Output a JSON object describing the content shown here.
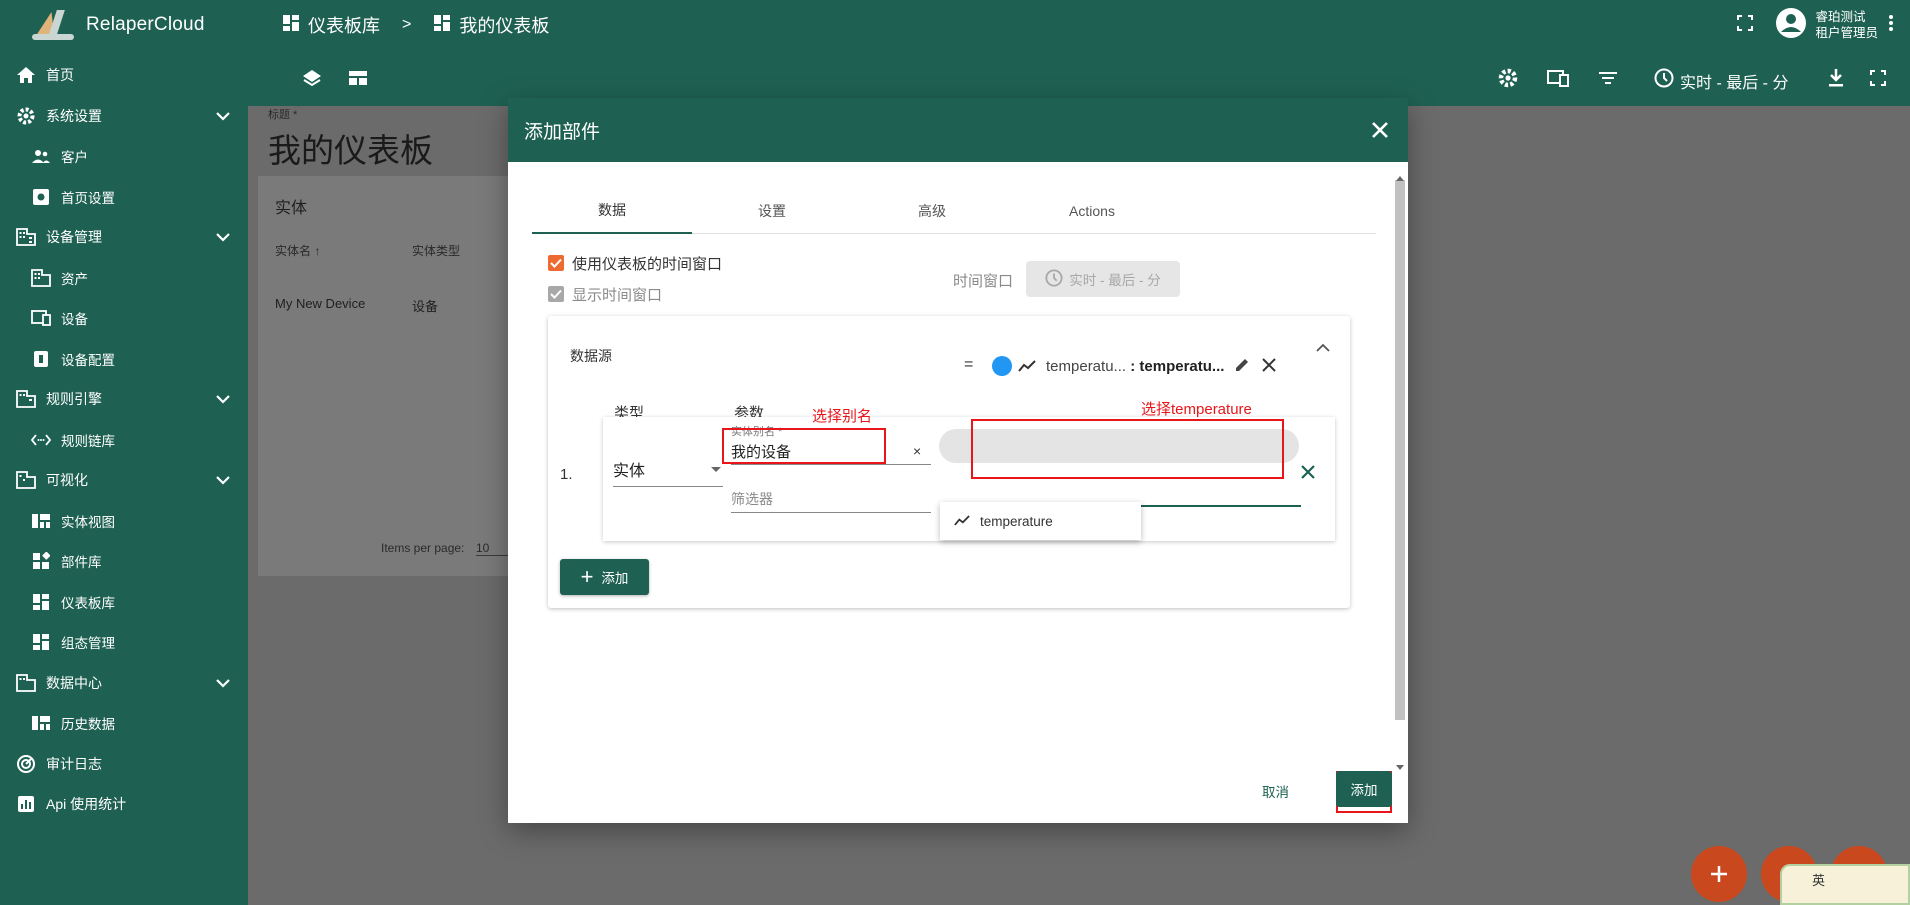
{
  "app": {
    "name": "RelaperCloud"
  },
  "sidebar": {
    "items": [
      {
        "label": "首页"
      },
      {
        "label": "系统设置"
      },
      {
        "label": "客户"
      },
      {
        "label": "首页设置"
      },
      {
        "label": "设备管理"
      },
      {
        "label": "资产"
      },
      {
        "label": "设备"
      },
      {
        "label": "设备配置"
      },
      {
        "label": "规则引擎"
      },
      {
        "label": "规则链库"
      },
      {
        "label": "可视化"
      },
      {
        "label": "实体视图"
      },
      {
        "label": "部件库"
      },
      {
        "label": "仪表板库"
      },
      {
        "label": "组态管理"
      },
      {
        "label": "数据中心"
      },
      {
        "label": "历史数据"
      },
      {
        "label": "审计日志"
      },
      {
        "label": "Api 使用统计"
      }
    ]
  },
  "breadcrumb": {
    "root": "仪表板库",
    "sep": ">",
    "current": "我的仪表板"
  },
  "user": {
    "name": "睿珀测试",
    "role": "租户管理员"
  },
  "toolbar": {
    "time_label": "实时 - 最后 - 分"
  },
  "dashboard": {
    "title_label": "标题 *",
    "title": "我的仪表板",
    "card_title": "实体",
    "col_name": "实体名 ↑",
    "col_type": "实体类型",
    "row_name": "My New Device",
    "row_type": "设备",
    "items_per_page_label": "Items per page:",
    "items_per_page": "10"
  },
  "dialog": {
    "title": "添加部件",
    "tabs": [
      "数据",
      "设置",
      "高级",
      "Actions"
    ],
    "use_dashboard_timewindow": "使用仪表板的时间窗口",
    "show_timewindow": "显示时间窗口",
    "timewindow_label": "时间窗口",
    "timewindow_value": "实时 - 最后 - 分",
    "datasource": {
      "title": "数据源",
      "col_type": "类型",
      "col_params": "参数",
      "row_index": "1.",
      "type_value": "实体",
      "alias_label": "实体别名 *",
      "alias_value": "我的设备",
      "alias_clear": "×",
      "filter_placeholder": "筛选器",
      "eq": "=",
      "key_chip_short": "temperatu...",
      "key_chip_sep": ":",
      "key_chip_label": "temperatu...",
      "dropdown_option": "temperature",
      "add_label": "添加"
    },
    "annotations": {
      "alias": "选择别名",
      "key": "选择temperature"
    },
    "cancel_label": "取消",
    "submit_label": "添加"
  },
  "colors": {
    "primary": "#1e6152",
    "accent": "#ee6a32",
    "annotation": "#e8161b",
    "fab": "#c9481e"
  }
}
